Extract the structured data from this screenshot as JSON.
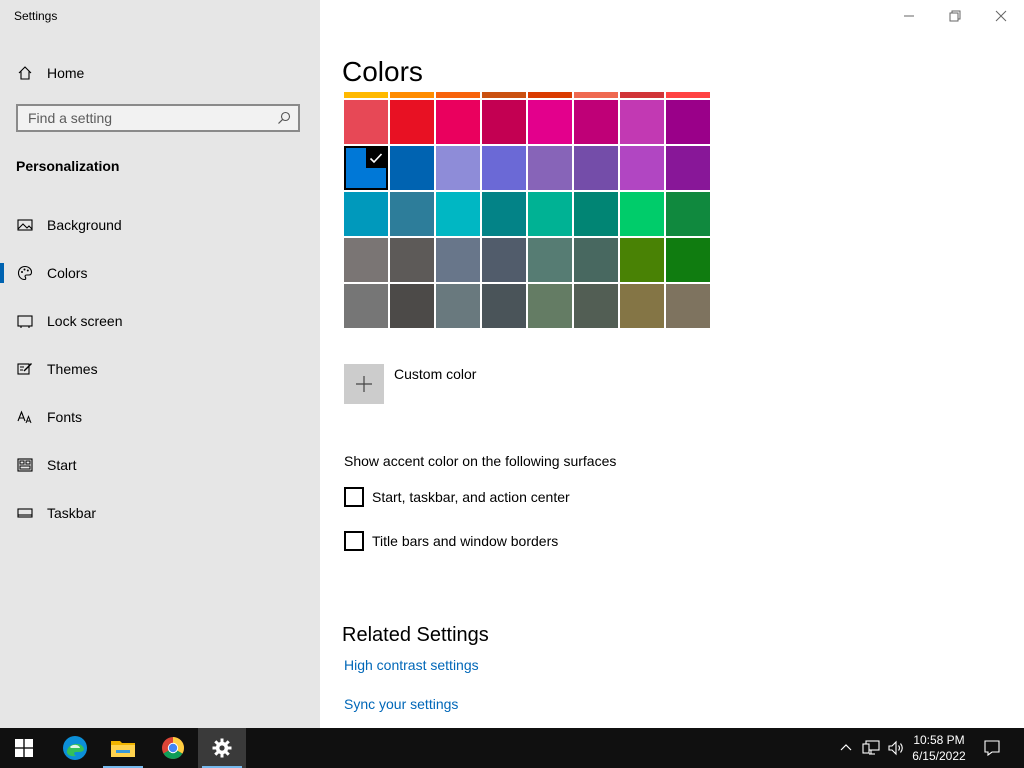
{
  "window": {
    "title": "Settings",
    "controls": [
      "minimize-icon",
      "restore-icon",
      "close-icon"
    ]
  },
  "sidebar": {
    "home_label": "Home",
    "search_placeholder": "Find a setting",
    "section_title": "Personalization",
    "items": [
      {
        "label": "Background",
        "icon": "background-icon",
        "selected": false
      },
      {
        "label": "Colors",
        "icon": "palette-icon",
        "selected": true
      },
      {
        "label": "Lock screen",
        "icon": "lock-screen-icon",
        "selected": false
      },
      {
        "label": "Themes",
        "icon": "themes-icon",
        "selected": false
      },
      {
        "label": "Fonts",
        "icon": "fonts-icon",
        "selected": false
      },
      {
        "label": "Start",
        "icon": "start-icon",
        "selected": false
      },
      {
        "label": "Taskbar",
        "icon": "taskbar-icon",
        "selected": false
      }
    ],
    "accent_color": "#0063b1"
  },
  "main": {
    "title": "Colors",
    "swatch_rows": [
      [
        "#ffb900",
        "#ff8c00",
        "#f7630c",
        "#ca5010",
        "#da3b01",
        "#ef6950",
        "#d13438",
        "#ff4343"
      ],
      [
        "#e74856",
        "#e81123",
        "#ea005e",
        "#c30052",
        "#e3008c",
        "#bf0077",
        "#c239b3",
        "#9a0089"
      ],
      [
        "#0078d7",
        "#0063b1",
        "#8e8cd8",
        "#6b69d6",
        "#8764b8",
        "#744da9",
        "#b146c2",
        "#881798"
      ],
      [
        "#0099bc",
        "#2d7d9a",
        "#00b7c3",
        "#038387",
        "#00b294",
        "#018574",
        "#00cc6a",
        "#10893e"
      ],
      [
        "#7a7574",
        "#5d5a58",
        "#68768a",
        "#515c6b",
        "#567c73",
        "#486860",
        "#498205",
        "#107c10"
      ],
      [
        "#767676",
        "#4c4a48",
        "#69797e",
        "#4a5459",
        "#647c64",
        "#525e54",
        "#847545",
        "#7e735f"
      ]
    ],
    "selected_swatch": {
      "row": 2,
      "col": 0
    },
    "custom_color_label": "Custom color",
    "accent_heading": "Show accent color on the following surfaces",
    "checkboxes": [
      {
        "label": "Start, taskbar, and action center",
        "checked": false
      },
      {
        "label": "Title bars and window borders",
        "checked": false
      }
    ],
    "related_heading": "Related Settings",
    "links": [
      "High contrast settings",
      "Sync your settings"
    ],
    "link_color": "#0067b8"
  },
  "taskbar": {
    "apps": [
      "windows-start-icon",
      "edge-icon",
      "file-explorer-icon",
      "chrome-icon",
      "settings-icon"
    ],
    "active_app": "settings-icon",
    "tray_icons": [
      "chevron-up-icon",
      "network-icon",
      "volume-icon"
    ],
    "time": "10:58 PM",
    "date": "6/15/2022",
    "notification_icon": "action-center-icon"
  }
}
